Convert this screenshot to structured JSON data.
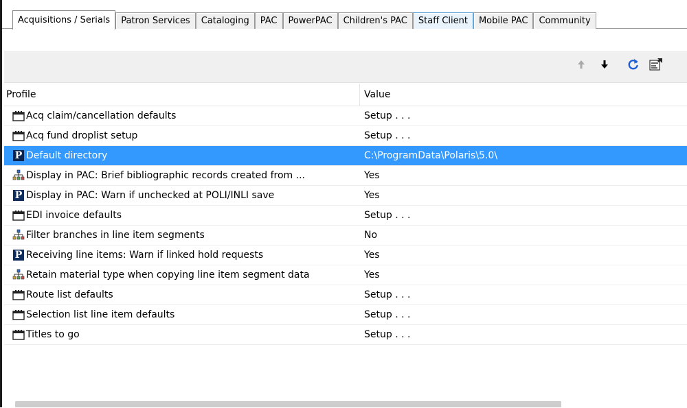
{
  "tabs": [
    {
      "label": "Acquisitions / Serials",
      "state": "active"
    },
    {
      "label": "Patron Services",
      "state": "normal"
    },
    {
      "label": "Cataloging",
      "state": "normal"
    },
    {
      "label": "PAC",
      "state": "normal"
    },
    {
      "label": "PowerPAC",
      "state": "normal"
    },
    {
      "label": "Children's PAC",
      "state": "normal"
    },
    {
      "label": "Staff Client",
      "state": "hover"
    },
    {
      "label": "Mobile PAC",
      "state": "normal"
    },
    {
      "label": "Community",
      "state": "normal"
    }
  ],
  "toolbar": {
    "move_up_icon": "arrow-up-icon",
    "move_down_icon": "arrow-down-icon",
    "refresh_icon": "refresh-icon",
    "properties_icon": "properties-icon"
  },
  "table": {
    "columns": {
      "profile": "Profile",
      "value": "Value"
    },
    "rows": [
      {
        "icon": "calendar-icon",
        "profile": "Acq claim/cancellation defaults",
        "value": "Setup . . .",
        "selected": false
      },
      {
        "icon": "calendar-icon",
        "profile": "Acq fund droplist setup",
        "value": "Setup . . .",
        "selected": false
      },
      {
        "icon": "polaris-p-icon",
        "profile": "Default directory",
        "value": "C:\\ProgramData\\Polaris\\5.0\\",
        "selected": true
      },
      {
        "icon": "org-hierarchy-icon",
        "profile": "Display in PAC: Brief bibliographic records created from ...",
        "value": "Yes",
        "selected": false
      },
      {
        "icon": "polaris-p-icon",
        "profile": "Display in PAC: Warn if unchecked at POLI/INLI save",
        "value": "Yes",
        "selected": false
      },
      {
        "icon": "calendar-icon",
        "profile": "EDI invoice defaults",
        "value": "Setup . . .",
        "selected": false
      },
      {
        "icon": "org-hierarchy-icon",
        "profile": "Filter branches in line item segments",
        "value": "No",
        "selected": false
      },
      {
        "icon": "polaris-p-icon",
        "profile": "Receiving line items: Warn if linked hold requests",
        "value": "Yes",
        "selected": false
      },
      {
        "icon": "org-hierarchy-icon",
        "profile": "Retain material type when copying line item segment data",
        "value": "Yes",
        "selected": false
      },
      {
        "icon": "calendar-icon",
        "profile": "Route list defaults",
        "value": "Setup . . .",
        "selected": false
      },
      {
        "icon": "calendar-icon",
        "profile": "Selection list line item defaults",
        "value": "Setup . . .",
        "selected": false
      },
      {
        "icon": "calendar-icon",
        "profile": "Titles to go",
        "value": "Setup . . .",
        "selected": false
      }
    ]
  },
  "colors": {
    "selection": "#3399ff",
    "polaris_icon_bg": "#0f2d5c",
    "toolbar_bg": "#f0f0f0"
  }
}
